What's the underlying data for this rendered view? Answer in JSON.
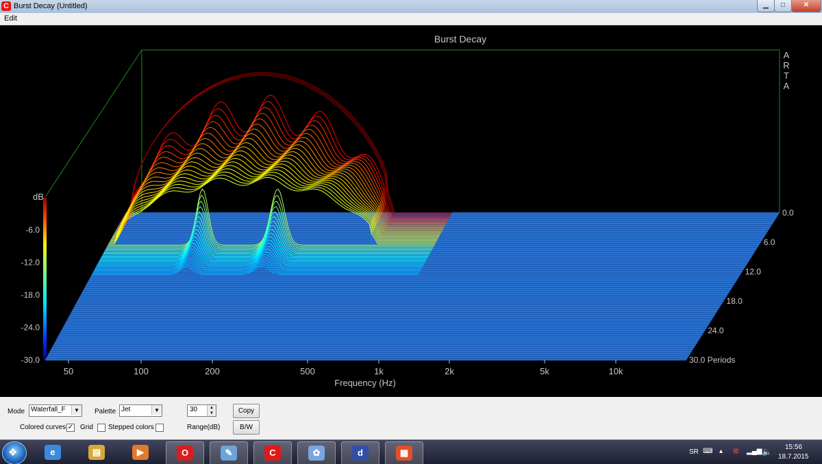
{
  "window": {
    "title": "Burst Decay  (Untitled)",
    "app_icon": "arta-c-icon",
    "min_glyph": "▁",
    "max_glyph": "□",
    "close_glyph": "✕"
  },
  "menu": {
    "edit": "Edit"
  },
  "plot": {
    "title": "Burst Decay",
    "watermark": [
      "A",
      "R",
      "T",
      "A"
    ],
    "db_label": "dB",
    "db_ticks": [
      "-6.0",
      "-12.0",
      "-18.0",
      "-24.0",
      "-30.0"
    ],
    "freq_ticks": [
      {
        "label": "50",
        "hz": 50
      },
      {
        "label": "100",
        "hz": 100
      },
      {
        "label": "200",
        "hz": 200
      },
      {
        "label": "500",
        "hz": 500
      },
      {
        "label": "1k",
        "hz": 1000
      },
      {
        "label": "2k",
        "hz": 2000
      },
      {
        "label": "5k",
        "hz": 5000
      },
      {
        "label": "10k",
        "hz": 10000
      }
    ],
    "xlabel": "Frequency (Hz)",
    "period_ticks": [
      "0.0",
      "6.0",
      "12.0",
      "18.0",
      "24.0",
      "30.0 Periods"
    ],
    "colors": {
      "background": "#000000",
      "floor": "#2f7fe0",
      "frame": "#1f8a1f",
      "text": "#c8c8c8"
    }
  },
  "controls": {
    "mode_label": "Mode",
    "mode_value": "Waterfall_F",
    "palette_label": "Palette",
    "palette_value": "Jet",
    "range_value": "30",
    "range_label": "Range(dB)",
    "copy_label": "Copy",
    "bw_label": "B/W",
    "colored_curves_label": "Colored curves",
    "colored_curves_checked": "✓",
    "grid_label": "Grid",
    "stepped_colors_label": "Stepped colors"
  },
  "taskbar": {
    "items": [
      {
        "name": "internet-explorer-icon",
        "glyph": "e",
        "color": "#3a8be0"
      },
      {
        "name": "file-explorer-icon",
        "glyph": "▤",
        "color": "#d9a83a"
      },
      {
        "name": "media-player-icon",
        "glyph": "▶",
        "color": "#e07a2a"
      },
      {
        "name": "opera-icon",
        "glyph": "O",
        "color": "#d81e1e"
      },
      {
        "name": "notepad-icon",
        "glyph": "✎",
        "color": "#6aa4d8"
      },
      {
        "name": "arta-icon",
        "glyph": "C",
        "color": "#e01a1a"
      },
      {
        "name": "paint-icon",
        "glyph": "✿",
        "color": "#7aa6e0"
      },
      {
        "name": "dsp-app-icon",
        "glyph": "d",
        "color": "#3050a8"
      },
      {
        "name": "windows-app-icon",
        "glyph": "▦",
        "color": "#e0502a"
      }
    ],
    "lang": "SR",
    "time": "15:56",
    "date": "18.7.2015"
  }
}
